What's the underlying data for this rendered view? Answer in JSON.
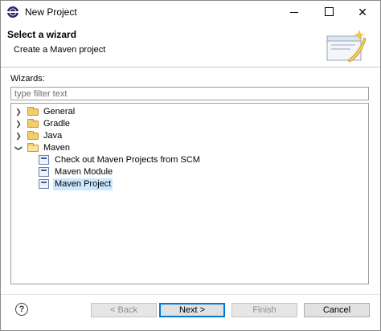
{
  "window": {
    "title": "New Project"
  },
  "banner": {
    "title": "Select a wizard",
    "description": "Create a Maven project"
  },
  "wizards": {
    "label": "Wizards:",
    "filter_placeholder": "type filter text",
    "tree": [
      {
        "label": "General",
        "expanded": false
      },
      {
        "label": "Gradle",
        "expanded": false
      },
      {
        "label": "Java",
        "expanded": false
      },
      {
        "label": "Maven",
        "expanded": true,
        "children": [
          {
            "label": "Check out Maven Projects from SCM"
          },
          {
            "label": "Maven Module"
          },
          {
            "label": "Maven Project",
            "selected": true
          }
        ]
      }
    ]
  },
  "footer": {
    "help": "?",
    "back_label": "< Back",
    "next_label": "Next >",
    "finish_label": "Finish",
    "cancel_label": "Cancel"
  },
  "colors": {
    "selection": "#cce8ff",
    "default_button_border": "#0078d7",
    "folder": "#f3cd6a"
  }
}
